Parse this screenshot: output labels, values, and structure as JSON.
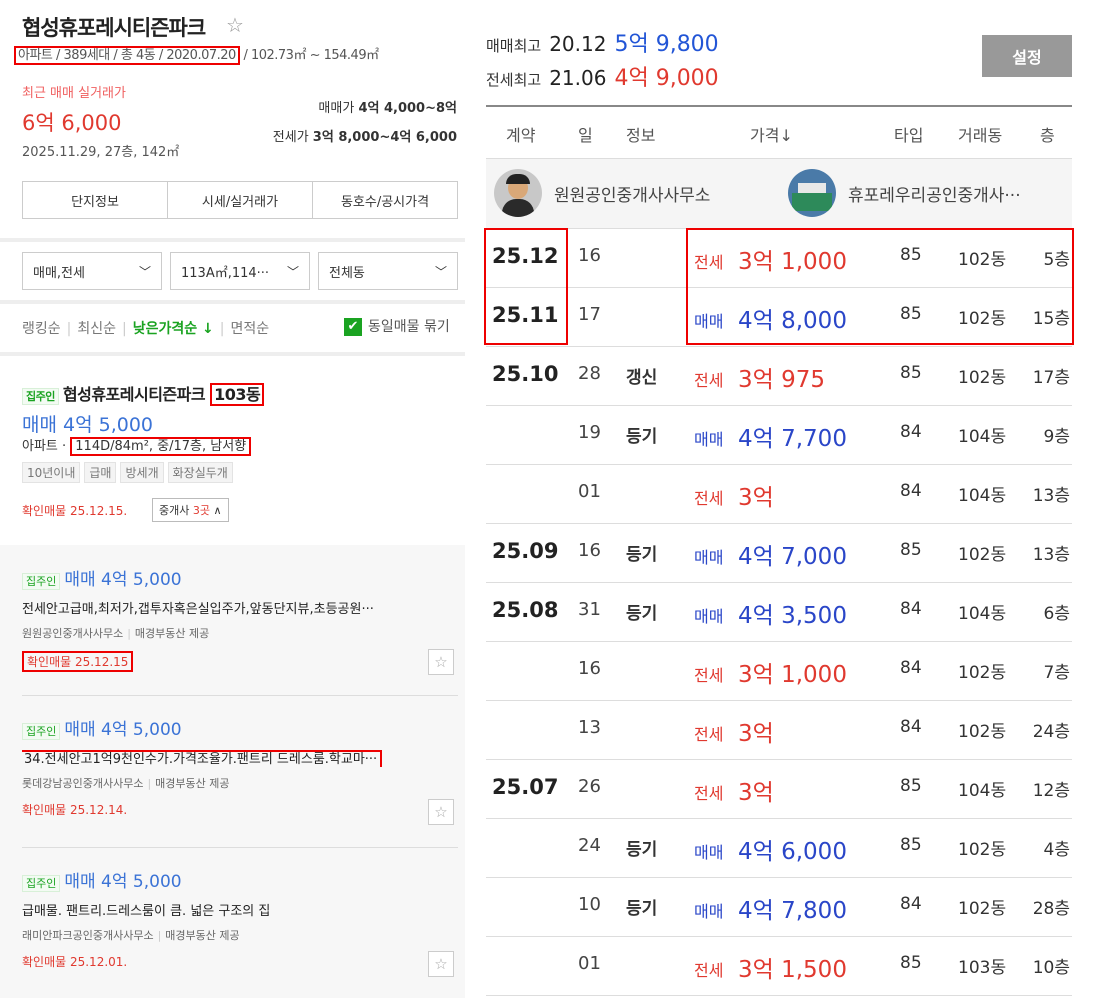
{
  "left": {
    "title": "협성휴포레시티즌파크",
    "star": "☆",
    "meta_boxed": "아파트 / 389세대 / 총 4동 / 2020.07.20",
    "meta_rest": " / 102.73㎡ ~ 154.49㎡",
    "recent_label": "최근 매매 실거래가",
    "recent_price": "6억 6,000",
    "recent_date": "2025.11.29, 27층, 142㎡",
    "range_sale_label": "매매가 ",
    "range_sale_value": "4억 4,000~8억",
    "range_jeonse_label": "전세가 ",
    "range_jeonse_value": "3억 8,000~4억 6,000",
    "tabs": [
      "단지정보",
      "시세/실거래가",
      "동호수/공시가격"
    ],
    "filters": [
      "매매,전세",
      "113A㎡,114···",
      "전체동"
    ],
    "sorts": {
      "s1": "랭킹순",
      "s2": "최신순",
      "s3": "낮은가격순 ↓",
      "s4": "면적순"
    },
    "dup_check": "동일매물 묶기",
    "card1": {
      "badge": "집주인",
      "name": "협성휴포레시티즌파크 ",
      "dong": "103동",
      "price": "매매 4억 5,000",
      "info_prefix": "아파트 · ",
      "info_boxed": "114D/84m², 중/17층, 남서향",
      "tags": [
        "10년이내",
        "급매",
        "방세개",
        "화장실두개"
      ],
      "confirm": "확인매물 25.12.15.",
      "agents_label": "중개사 ",
      "agents_num": "3곳",
      "agents_chev": " ∧"
    },
    "subs": [
      {
        "badge": "집주인",
        "price": "매매 4억 5,000",
        "desc": "전세안고급매,최저가,갭투자혹은실입주가,앞동단지뷰,초등공원···",
        "agent": "원원공인중개사사무소",
        "provider": "매경부동산 제공",
        "confirm": "확인매물 25.12.15"
      },
      {
        "badge": "집주인",
        "price": "매매 4억 5,000",
        "desc": "34.전세안고1억9천인수가.가격조율가.팬트리 드레스룸.학교마···",
        "agent": "롯데강남공인중개사사무소",
        "provider": "매경부동산 제공",
        "confirm": "확인매물 25.12.14."
      },
      {
        "badge": "집주인",
        "price": "매매 4억 5,000",
        "desc": "급매물. 팬트리.드레스룸이 큼. 넓은 구조의 집",
        "agent": "래미안파크공인중개사사무소",
        "provider": "매경부동산 제공",
        "confirm": "확인매물 25.12.01."
      }
    ],
    "fav": "☆"
  },
  "right": {
    "stat1": {
      "label": "매매최고",
      "date": "20.12",
      "value": "5억 9,800"
    },
    "stat2": {
      "label": "전세최고",
      "date": "21.06",
      "value": "4억 9,000"
    },
    "settings": "설정",
    "headers": {
      "contract": "계약",
      "day": "일",
      "info": "정보",
      "price": "가격↓",
      "type": "타입",
      "dong": "거래동",
      "floor": "층"
    },
    "agent1": "원원공인중개사사무소",
    "agent2": "휴포레우리공인중개사···",
    "rows": [
      {
        "month": "25.12",
        "day": "16",
        "info": "",
        "kind": "전세",
        "amount": "3억 1,000",
        "type": "85",
        "dong": "102동",
        "floor": "5층"
      },
      {
        "month": "25.11",
        "day": "17",
        "info": "",
        "kind": "매매",
        "amount": "4억 8,000",
        "type": "85",
        "dong": "102동",
        "floor": "15층"
      },
      {
        "month": "25.10",
        "day": "28",
        "info": "갱신",
        "kind": "전세",
        "amount": "3억 975",
        "type": "85",
        "dong": "102동",
        "floor": "17층"
      },
      {
        "month": "",
        "day": "19",
        "info": "등기",
        "kind": "매매",
        "amount": "4억 7,700",
        "type": "84",
        "dong": "104동",
        "floor": "9층"
      },
      {
        "month": "",
        "day": "01",
        "info": "",
        "kind": "전세",
        "amount": "3억",
        "type": "84",
        "dong": "104동",
        "floor": "13층"
      },
      {
        "month": "25.09",
        "day": "16",
        "info": "등기",
        "kind": "매매",
        "amount": "4억 7,000",
        "type": "85",
        "dong": "102동",
        "floor": "13층"
      },
      {
        "month": "25.08",
        "day": "31",
        "info": "등기",
        "kind": "매매",
        "amount": "4억 3,500",
        "type": "84",
        "dong": "104동",
        "floor": "6층"
      },
      {
        "month": "",
        "day": "16",
        "info": "",
        "kind": "전세",
        "amount": "3억 1,000",
        "type": "84",
        "dong": "102동",
        "floor": "7층"
      },
      {
        "month": "",
        "day": "13",
        "info": "",
        "kind": "전세",
        "amount": "3억",
        "type": "84",
        "dong": "102동",
        "floor": "24층"
      },
      {
        "month": "25.07",
        "day": "26",
        "info": "",
        "kind": "전세",
        "amount": "3억",
        "type": "85",
        "dong": "104동",
        "floor": "12층"
      },
      {
        "month": "",
        "day": "24",
        "info": "등기",
        "kind": "매매",
        "amount": "4억 6,000",
        "type": "85",
        "dong": "102동",
        "floor": "4층"
      },
      {
        "month": "",
        "day": "10",
        "info": "등기",
        "kind": "매매",
        "amount": "4억 7,800",
        "type": "84",
        "dong": "102동",
        "floor": "28층"
      },
      {
        "month": "",
        "day": "01",
        "info": "",
        "kind": "전세",
        "amount": "3억 1,500",
        "type": "85",
        "dong": "103동",
        "floor": "10층"
      }
    ]
  }
}
